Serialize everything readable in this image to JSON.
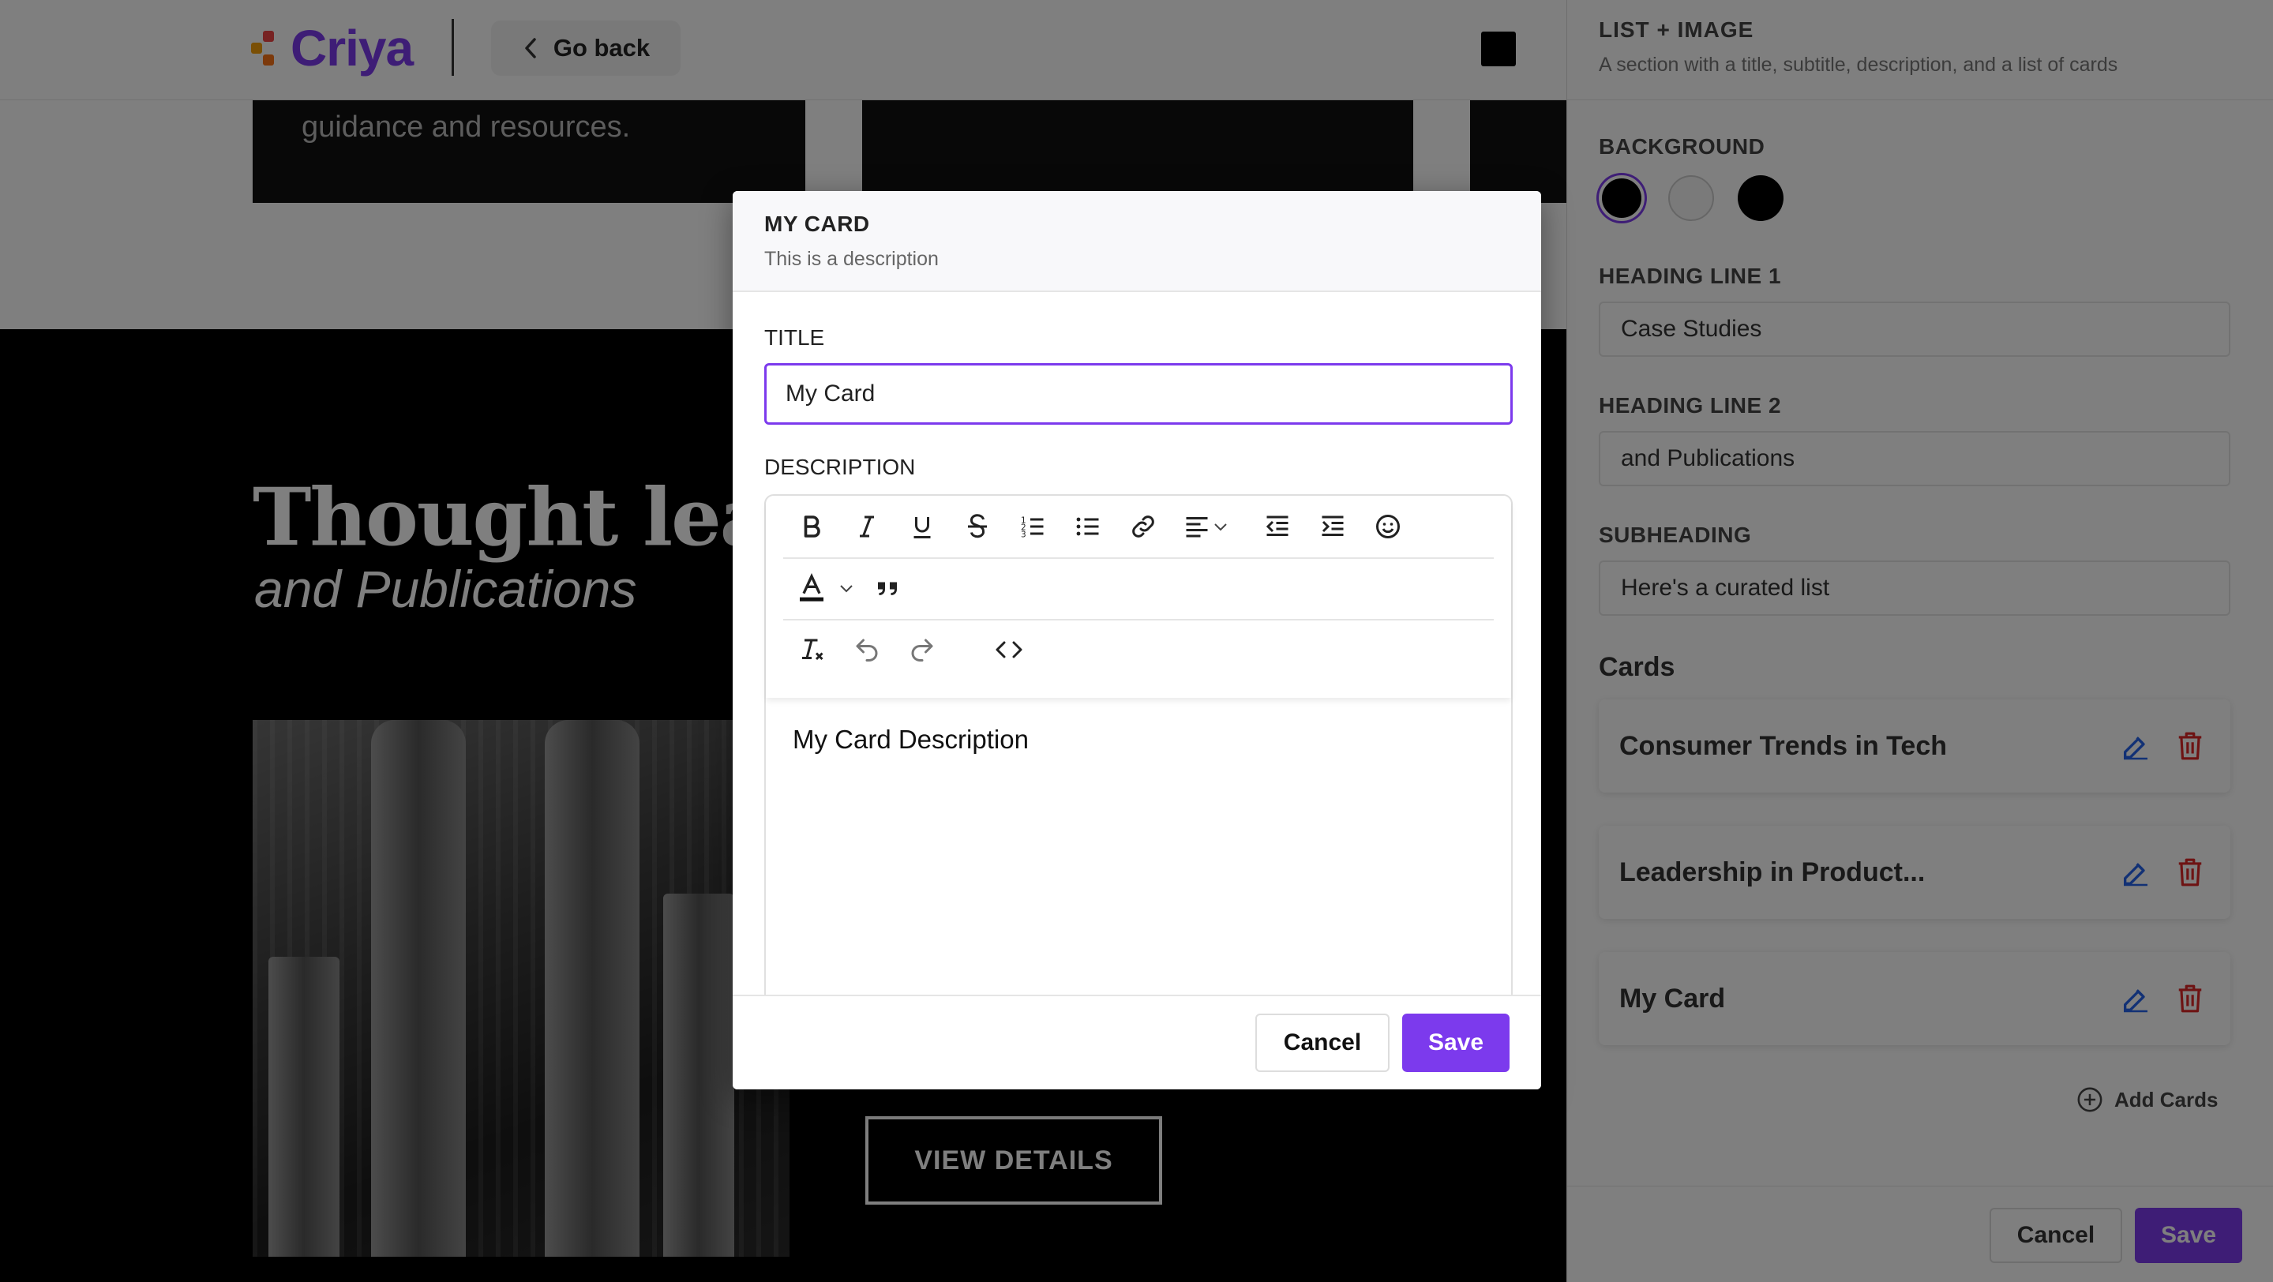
{
  "header": {
    "logo_text": "Criya",
    "go_back_label": "Go back"
  },
  "preview": {
    "hero_card_text": "guidance and resources.",
    "heading": "Thought leade",
    "subheading": "and Publications",
    "view_details_label": "VIEW DETAILS"
  },
  "panel": {
    "title": "LIST + IMAGE",
    "description": "A section with a title, subtitle, description, and a list of cards",
    "background_label": "BACKGROUND",
    "background_swatches": [
      "#000000",
      "#f4f4f4",
      "#000000"
    ],
    "heading_line_1_label": "HEADING LINE 1",
    "heading_line_1_value": "Case Studies",
    "heading_line_2_label": "HEADING LINE 2",
    "heading_line_2_value": "and Publications",
    "subheading_label": "SUBHEADING",
    "subheading_value": "Here's a curated list",
    "cards_heading": "Cards",
    "cards": [
      {
        "title": "Consumer Trends in Tech"
      },
      {
        "title": "Leadership in Product..."
      },
      {
        "title": "My Card"
      }
    ],
    "add_cards_label": "Add Cards",
    "cancel_label": "Cancel",
    "save_label": "Save"
  },
  "modal": {
    "title": "MY CARD",
    "description": "This is a description",
    "title_label": "TITLE",
    "title_value": "My Card",
    "description_label": "DESCRIPTION",
    "description_content": "My Card Description",
    "toolbar_icons": [
      "bold-icon",
      "italic-icon",
      "underline-icon",
      "strikethrough-icon",
      "ordered-list-icon",
      "bullet-list-icon",
      "link-icon",
      "align-left-icon",
      "outdent-icon",
      "indent-icon",
      "emoji-icon",
      "text-color-icon",
      "blockquote-icon",
      "clear-format-icon",
      "undo-icon",
      "redo-icon",
      "code-icon"
    ],
    "cancel_label": "Cancel",
    "save_label": "Save"
  },
  "colors": {
    "accent": "#7c3aed",
    "delete": "#dc2626",
    "edit": "#2563eb"
  }
}
